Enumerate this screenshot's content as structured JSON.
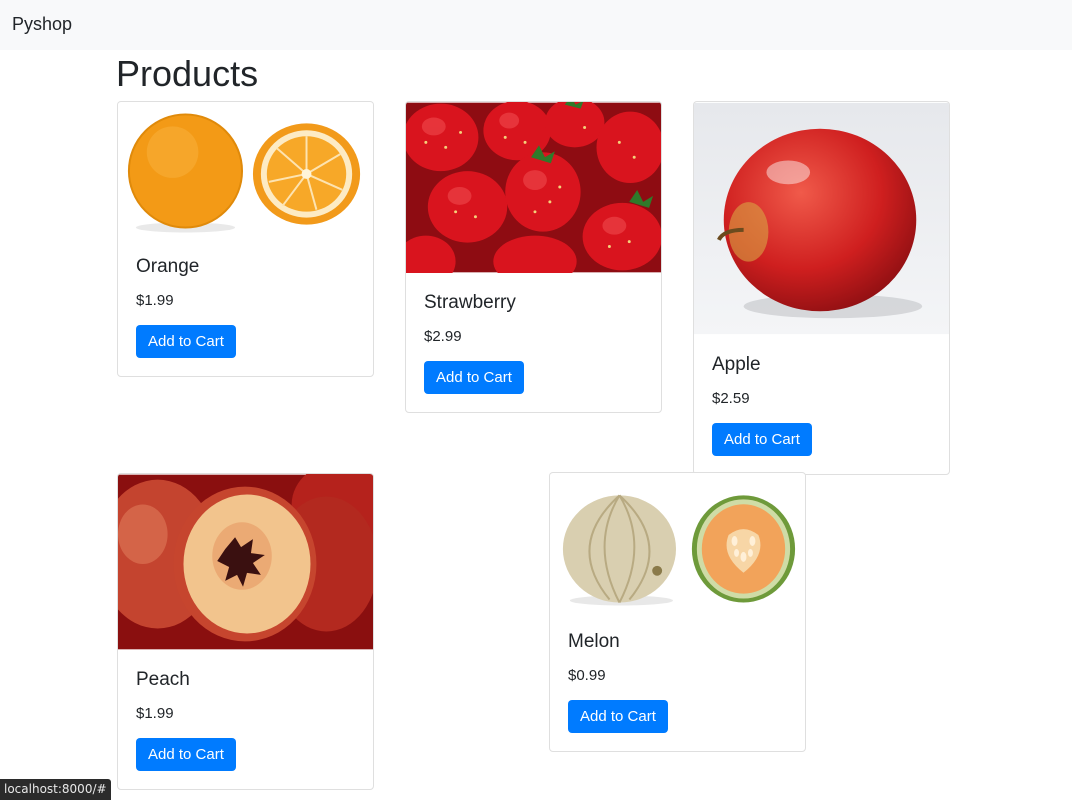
{
  "navbar": {
    "brand": "Pyshop"
  },
  "page": {
    "title": "Products"
  },
  "products": [
    {
      "name": "Orange",
      "price": "$1.99",
      "button": "Add to Cart",
      "image": "orange-image"
    },
    {
      "name": "Strawberry",
      "price": "$2.99",
      "button": "Add to Cart",
      "image": "strawberry-image"
    },
    {
      "name": "Apple",
      "price": "$2.59",
      "button": "Add to Cart",
      "image": "apple-image"
    },
    {
      "name": "Peach",
      "price": "$1.99",
      "button": "Add to Cart",
      "image": "peach-image"
    },
    {
      "name": "Melon",
      "price": "$0.99",
      "button": "Add to Cart",
      "image": "melon-image"
    }
  ],
  "status_bar": {
    "url": "localhost:8000/#"
  },
  "colors": {
    "primary": "#007bff",
    "navbar_bg": "#f8f9fa",
    "text": "#212529"
  }
}
